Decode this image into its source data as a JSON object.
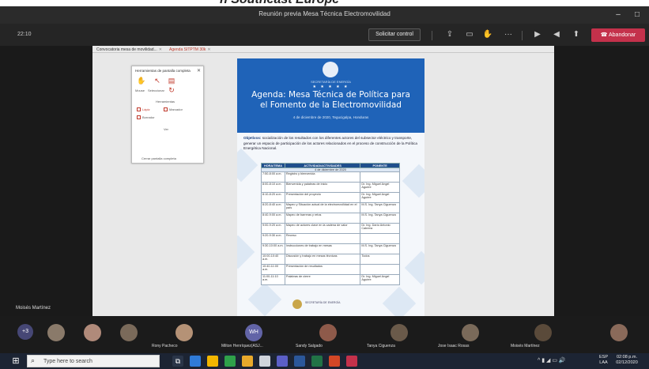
{
  "caption": {
    "text": "n Southeast Europe"
  },
  "window": {
    "title": "Reunión previa Mesa Técnica Electromovilidad",
    "minimize": "–",
    "maximize": "□"
  },
  "toolbar": {
    "timer": "22:10",
    "request_control": "Solicitar control",
    "leave": "Abandonar",
    "icons": [
      "share-icon",
      "chat-icon",
      "raise-hand-icon",
      "more-icon",
      "camera-icon",
      "mic-icon",
      "share-screen-icon"
    ]
  },
  "document_window": {
    "tabs": [
      {
        "label": "Convocatoria mesa de movilidad..."
      },
      {
        "label": "Agenda SITPTM 30k"
      }
    ]
  },
  "tool_panel": {
    "header": "Herramientas de pantalla completa",
    "mouse_label": "Mouse",
    "select_label": "Seleccionar",
    "section_label": "Herramientas",
    "options": [
      "Lápiz",
      "Marcador",
      "Borrador"
    ],
    "view_label": "Ver",
    "close_label": "Cerrar pantalla completa"
  },
  "agenda": {
    "institution": "SECRETARÍA DE ENERGÍA",
    "stars": "★ ★ ★ ★ ★",
    "title_line1": "Agenda: Mesa Técnica de Política para",
    "title_line2": "el Fomento de la Electromovilidad",
    "subtitle": "4 de diciembre de 2020, Tegucigalpa, Honduras",
    "objectives_label": "Objetivos:",
    "objectives_text": "socialización de los resultados con los diferentes actores del subsector eléctrico y transporte, generar un espacio de participación de los actores relacionados en el proceso de construcción de la Política Energética Nacional.",
    "table_headers": [
      "HORA/TEMA",
      "ACTIVIDAD/ACTIVIDADES",
      "PONENTE"
    ],
    "table_subheader": "4 de diciembre de 2020",
    "rows": [
      {
        "time": "7:50-8:00 a.m.",
        "activity": "Registro y bienvenida",
        "speaker": ""
      },
      {
        "time": "8:00-8:10 a.m.",
        "activity": "Bienvenida y palabras de inicio",
        "speaker": "Dr. Ing. Miguel Angel Aguirre"
      },
      {
        "time": "8:10-8:20 a.m.",
        "activity": "Presentación del proyecto",
        "speaker": "Dr. Ing. Miguel Angel Aguirre"
      },
      {
        "time": "8:20-8:40 a.m.",
        "activity": "Mapeo y Situación actual de la electromovilidad en el país",
        "speaker": "M.S. Ing. Tanya Ciguenza"
      },
      {
        "time": "8:40-9:00 a.m.",
        "activity": "Mapeo de barreras y retos",
        "speaker": "M.S. Ing. Tanya Ciguenza"
      },
      {
        "time": "9:00-9:20 a.m.",
        "activity": "Mapeo de actores clave en la cadena de valor",
        "speaker": "Dr. Ing. Darío Antonio Cabrera"
      },
      {
        "time": "9:20-9:30 a.m.",
        "activity": "Receso",
        "speaker": ""
      },
      {
        "time": "9:30-10:00 a.m.",
        "activity": "Instrucciones de trabajo en mesas",
        "speaker": "M.S. Ing. Tanya Ciguenza"
      },
      {
        "time": "10:00-10:40 a.m.",
        "activity": "Discusión y trabajo en mesas técnicas",
        "speaker": "Todos"
      },
      {
        "time": "10:40-11:00 a.m.",
        "activity": "Presentación de resultados",
        "speaker": ""
      },
      {
        "time": "11:00-11:10 a.m.",
        "activity": "Palabras de cierre",
        "speaker": "Dr. Ing. Miguel Angel Aguirre"
      }
    ],
    "footer": "SECRETARÍA DE ENERGÍA"
  },
  "presenter": {
    "name": "Moisés Martínez"
  },
  "participants": {
    "more_count": "+3",
    "tiles": [
      {
        "name": "",
        "color": "#8a7a6a"
      },
      {
        "name": "",
        "color": "#b08a7a"
      },
      {
        "name": "",
        "color": "#7a6a5a"
      },
      {
        "name": "Rony Pacheco",
        "color": "#b59276"
      },
      {
        "name": "Milton Henríquez(ASJ...",
        "initials": "WH",
        "color": "#6264a7"
      },
      {
        "name": "Sandy Salgado",
        "color": "#8e5a4a"
      },
      {
        "name": "Tanya Ciguenza",
        "color": "#6a5a4a"
      },
      {
        "name": "Jose Isaac Rosas",
        "color": "#7a6a5a"
      },
      {
        "name": "Moisés Martínez",
        "color": "#5a4a3a"
      },
      {
        "name": "",
        "color": "#8a6a5a"
      }
    ]
  },
  "taskbar": {
    "search_placeholder": "Type here to search",
    "lang": "ESP",
    "lang_sub": "LAA",
    "time": "02:08 p.m.",
    "date": "02/12/2020"
  }
}
